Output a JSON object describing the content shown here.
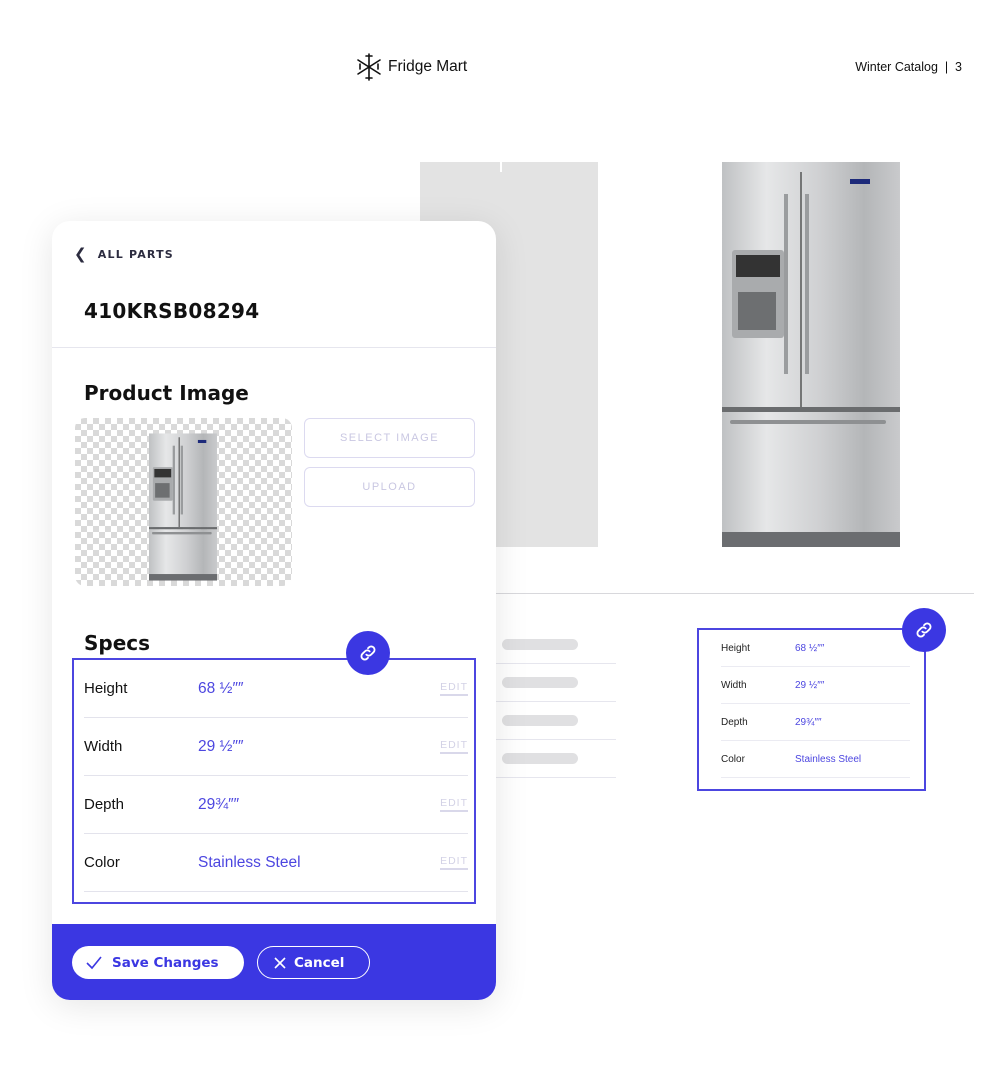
{
  "header": {
    "brand_icon": "snowflake-icon",
    "brand_name": "Fridge Mart",
    "catalog_label": "Winter Catalog  |  3"
  },
  "colors": {
    "accent": "#3b37e2",
    "accent_text": "#4c46e0",
    "muted": "#d3d2e6"
  },
  "card": {
    "back_icon": "chevron-left-icon",
    "back_label": "ALL PARTS",
    "part_number": "410KRSB08294",
    "product_image_title": "Product Image",
    "select_image_label": "SELECT IMAGE",
    "upload_label": "UPLOAD",
    "specs_title": "Specs",
    "link_icon": "link-icon",
    "specs": [
      {
        "label": "Height",
        "value": "68 ½″″",
        "action": "EDIT"
      },
      {
        "label": "Width",
        "value": "29 ½″″",
        "action": "EDIT"
      },
      {
        "label": "Depth",
        "value": "29¾″″",
        "action": "EDIT"
      },
      {
        "label": "Color",
        "value": "Stainless Steel",
        "action": "EDIT"
      }
    ],
    "footer": {
      "save_icon": "check-icon",
      "save_label": "Save Changes",
      "cancel_icon": "close-icon",
      "cancel_label": "Cancel"
    }
  },
  "preview_specs": [
    {
      "label": "Height",
      "value": "68 ½″″"
    },
    {
      "label": "Width",
      "value": "29 ½″″"
    },
    {
      "label": "Depth",
      "value": "29¾″″"
    },
    {
      "label": "Color",
      "value": "Stainless Steel"
    }
  ]
}
